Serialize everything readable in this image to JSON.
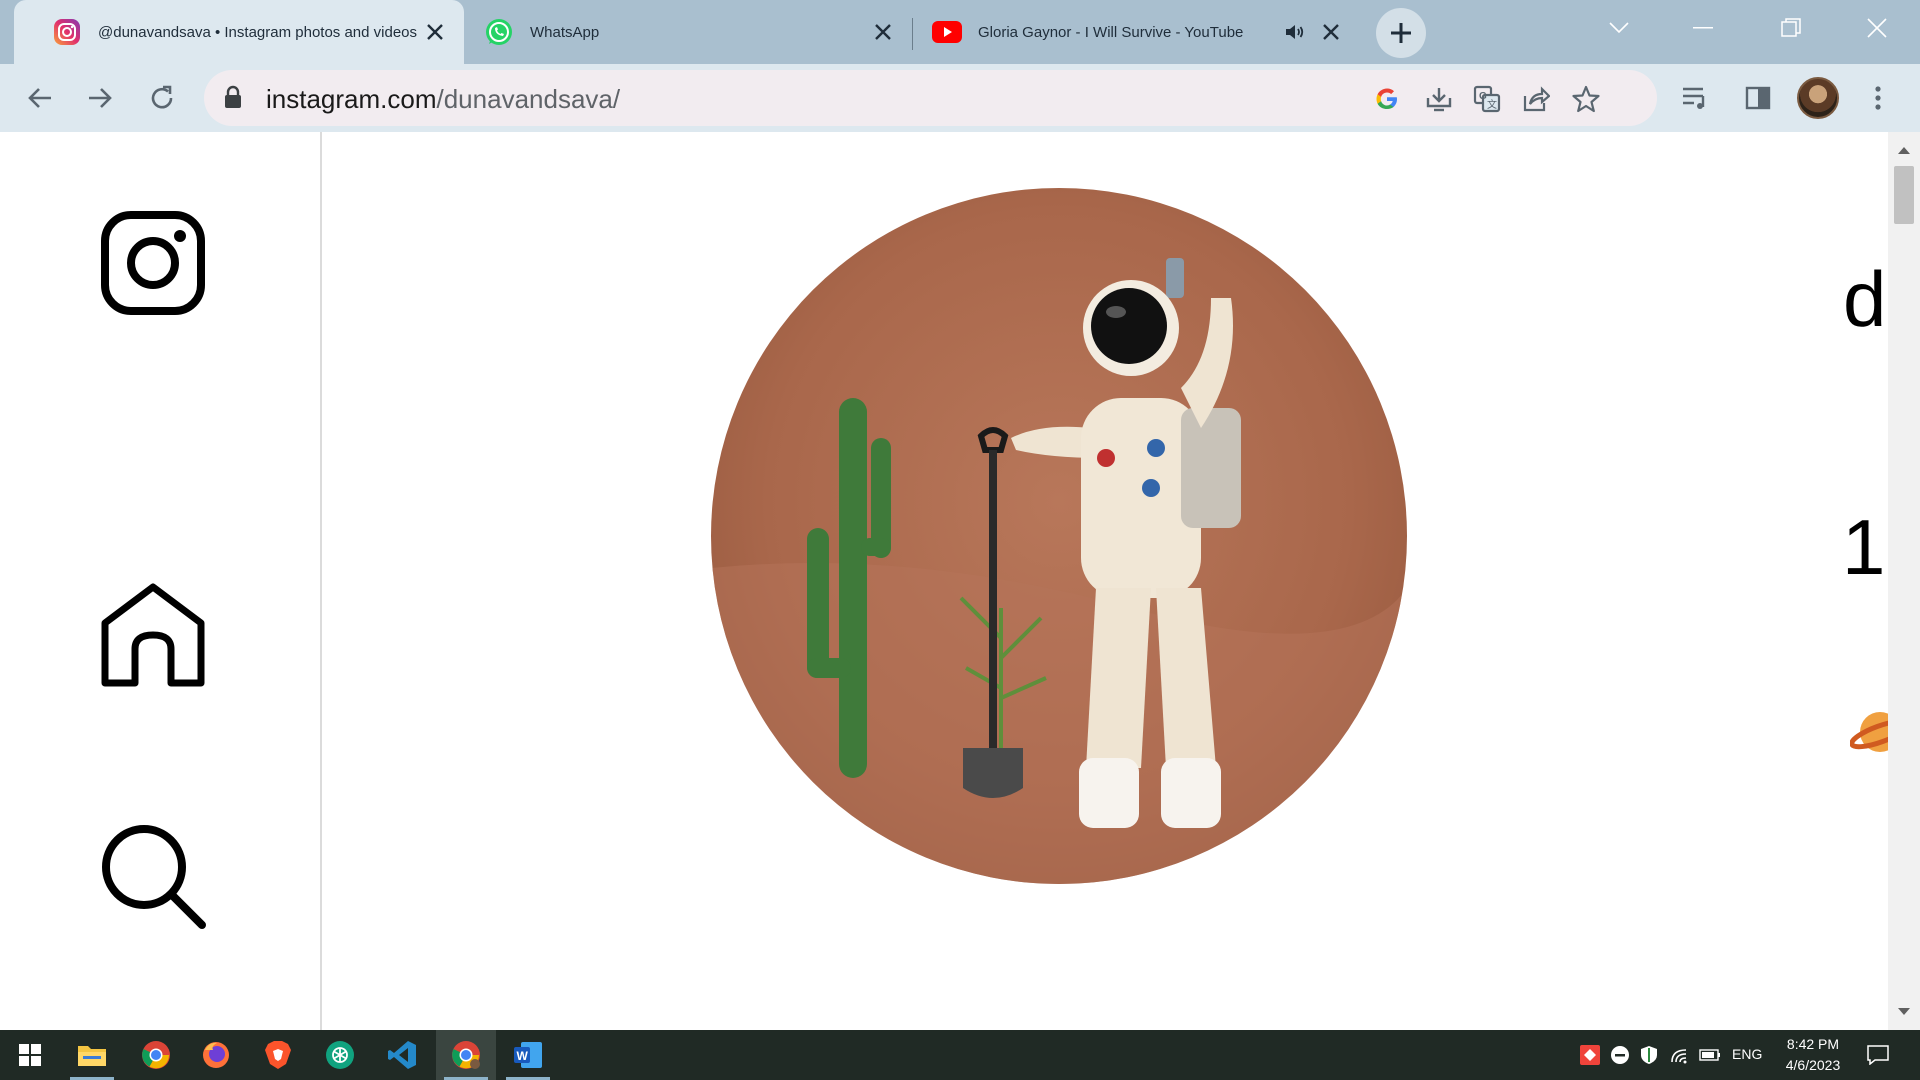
{
  "browser": {
    "tabs": [
      {
        "title": "@dunavandsava • Instagram photos and videos",
        "icon": "instagram-icon",
        "active": true
      },
      {
        "title": "WhatsApp",
        "icon": "whatsapp-icon",
        "active": false
      },
      {
        "title": "Gloria Gaynor - I Will Survive - YouTube",
        "icon": "youtube-icon",
        "active": false,
        "audio": true
      }
    ],
    "address": {
      "domain": "instagram.com",
      "path": "/dunavandsava/"
    }
  },
  "page": {
    "sidebar": [
      {
        "name": "instagram-logo-icon"
      },
      {
        "name": "home-icon"
      },
      {
        "name": "search-icon"
      }
    ],
    "profile_username_partial": "d",
    "profile_stat_partial": "1,",
    "bio_emoji": "saturn-emoji"
  },
  "taskbar": {
    "apps": [
      "start",
      "file-explorer",
      "chrome",
      "firefox",
      "brave",
      "chatgpt",
      "vscode",
      "chrome-active",
      "word"
    ],
    "language": "ENG",
    "time": "8:42 PM",
    "date": "4/6/2023"
  },
  "colors": {
    "tabstrip": "#a9bfcf",
    "toolbar": "#dde8ef",
    "omnibox": "#f2ecf0",
    "taskbar": "#202a25",
    "avatar_ground": "#b06b4d"
  }
}
